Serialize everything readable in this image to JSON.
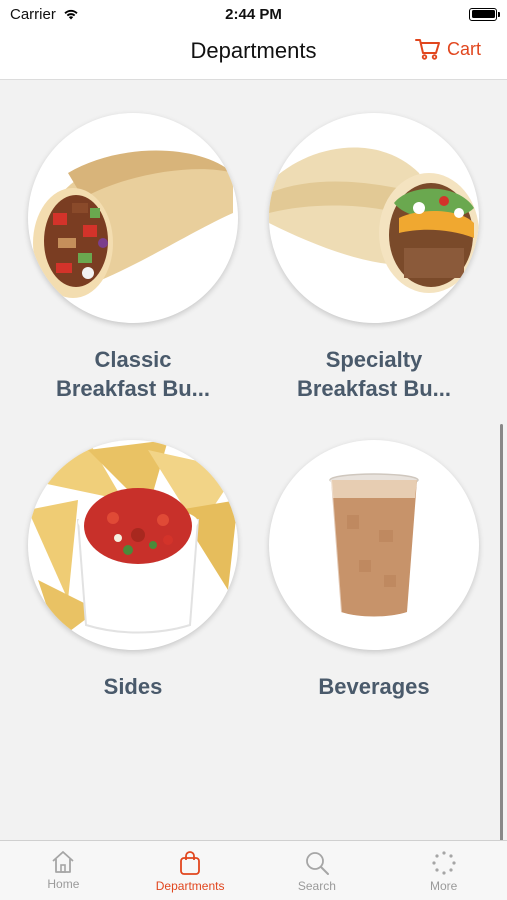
{
  "status_bar": {
    "carrier": "Carrier",
    "time": "2:44 PM"
  },
  "nav": {
    "title": "Departments",
    "cart_label": "Cart"
  },
  "departments": [
    {
      "label": "Classic\nBreakfast Bu...",
      "image": "burrito-icon"
    },
    {
      "label": "Specialty\nBreakfast Bu...",
      "image": "burrito-icon"
    },
    {
      "label": "Sides",
      "image": "chips-salsa-icon"
    },
    {
      "label": "Beverages",
      "image": "iced-coffee-icon"
    }
  ],
  "tabs": [
    {
      "label": "Home",
      "icon": "home-icon",
      "active": false
    },
    {
      "label": "Departments",
      "icon": "bag-icon",
      "active": true
    },
    {
      "label": "Search",
      "icon": "search-icon",
      "active": false
    },
    {
      "label": "More",
      "icon": "more-icon",
      "active": false
    }
  ],
  "colors": {
    "accent": "#e1461e",
    "label": "#4a5a6b",
    "background": "#f2f2f2"
  }
}
